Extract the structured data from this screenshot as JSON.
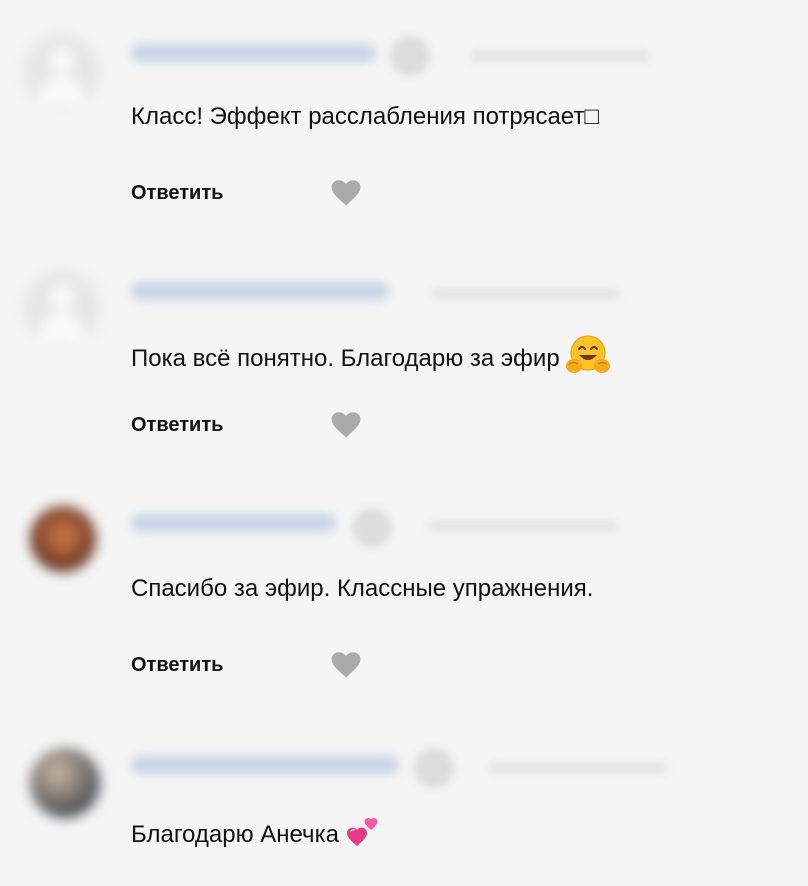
{
  "comments": [
    {
      "text": "Класс! Эффект расслабления потрясает",
      "trailing_glyph": "□",
      "reply_label": "Ответить",
      "avatar": "default-avatar-icon"
    },
    {
      "text": "Пока всё понятно. Благодарю за эфир",
      "emoji": "hugging-face-icon",
      "reply_label": "Ответить",
      "avatar": "default-avatar-icon"
    },
    {
      "text": "Спасибо за эфир. Классные упражнения.",
      "reply_label": "Ответить",
      "avatar": "photo-avatar"
    },
    {
      "text": "Благодарю Анечка",
      "emoji": "two-hearts-icon",
      "avatar": "photo-avatar"
    }
  ],
  "colors": {
    "background": "#f5f5f5",
    "like_heart": "#aaaaaa",
    "text": "#111111"
  }
}
